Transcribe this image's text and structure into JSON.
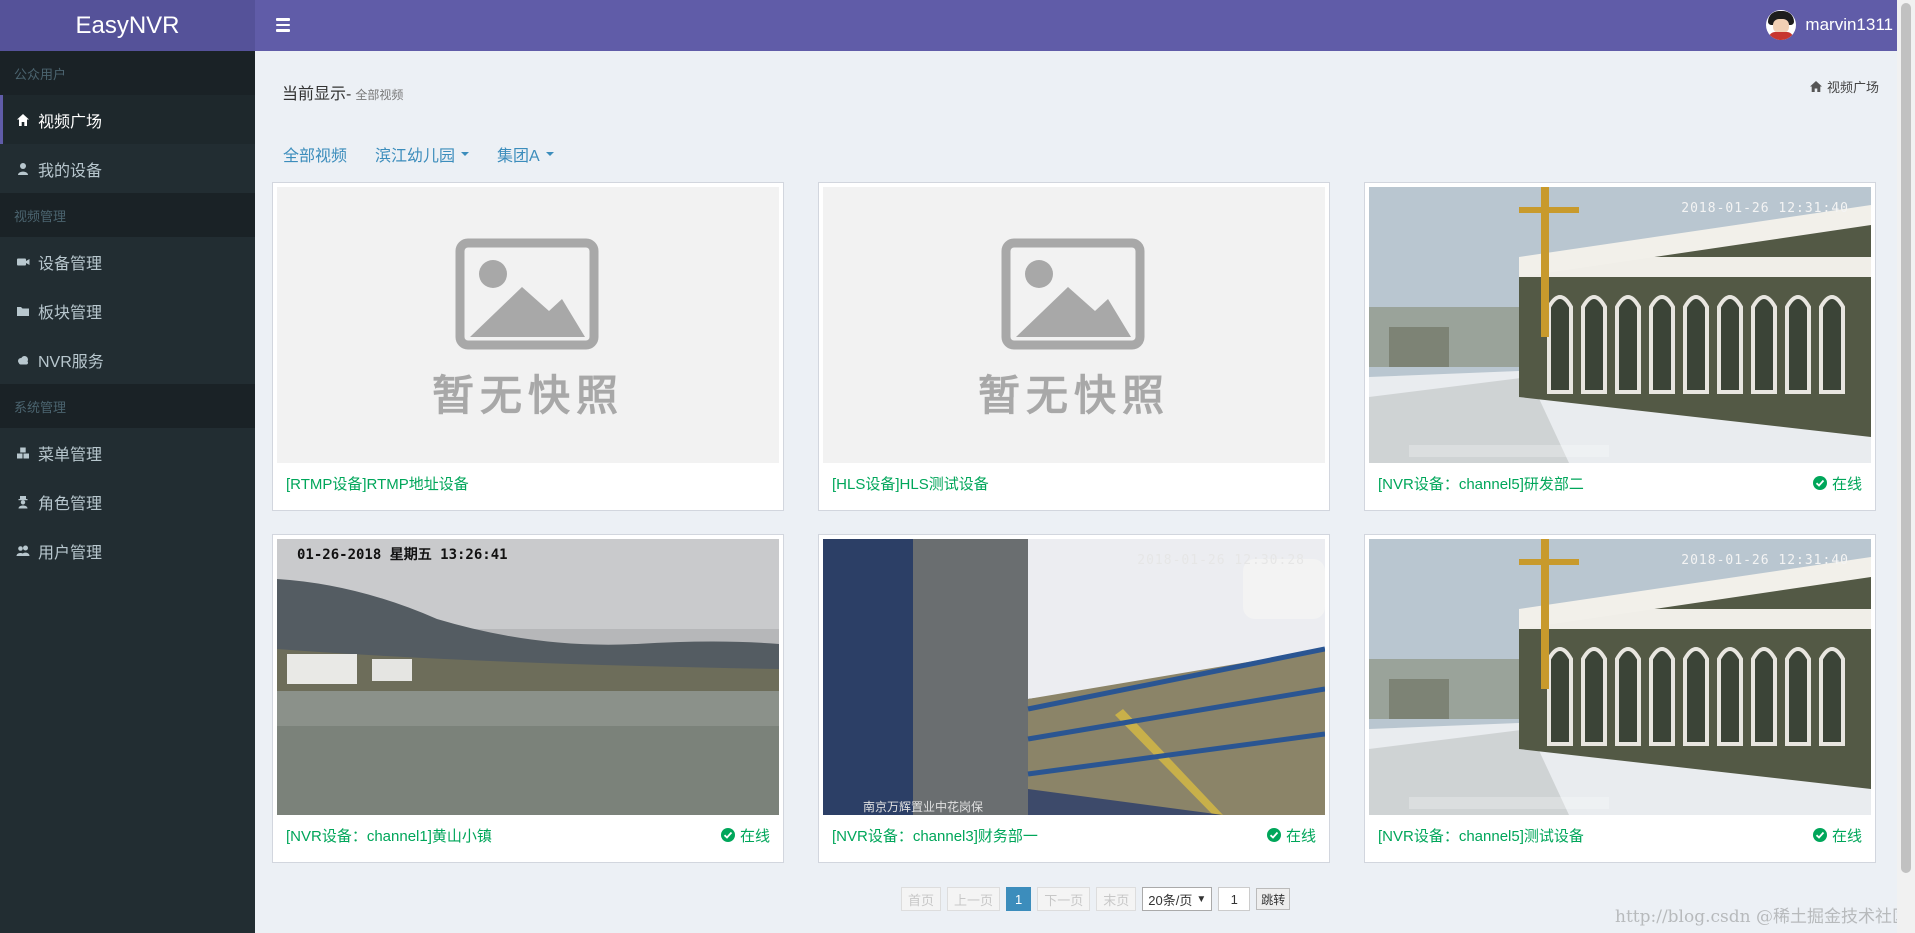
{
  "app": {
    "title": "EasyNVR"
  },
  "user": {
    "name": "marvin1311"
  },
  "sidebar": {
    "sections": [
      {
        "header": "公众用户",
        "items": [
          {
            "label": "视频广场",
            "icon": "home-icon",
            "active": true
          },
          {
            "label": "我的设备",
            "icon": "user-icon",
            "active": false
          }
        ]
      },
      {
        "header": "视频管理",
        "items": [
          {
            "label": "设备管理",
            "icon": "video-camera-icon",
            "active": false
          },
          {
            "label": "板块管理",
            "icon": "folder-icon",
            "active": false
          },
          {
            "label": "NVR服务",
            "icon": "cloud-icon",
            "active": false
          }
        ]
      },
      {
        "header": "系统管理",
        "items": [
          {
            "label": "菜单管理",
            "icon": "cubes-icon",
            "active": false
          },
          {
            "label": "角色管理",
            "icon": "user-secret-icon",
            "active": false
          },
          {
            "label": "用户管理",
            "icon": "users-icon",
            "active": false
          }
        ]
      }
    ]
  },
  "content": {
    "title": "当前显示-",
    "subtitle": "全部视频",
    "breadcrumb": "视频广场"
  },
  "filters": [
    {
      "label": "全部视频",
      "dropdown": false
    },
    {
      "label": "滨江幼儿园",
      "dropdown": true
    },
    {
      "label": "集团A",
      "dropdown": true
    }
  ],
  "cards": [
    {
      "name": "[RTMP设备]RTMP地址设备",
      "status": "",
      "thumb": "placeholder",
      "placeholder_text": "暂无快照"
    },
    {
      "name": "[HLS设备]HLS测试设备",
      "status": "",
      "thumb": "placeholder",
      "placeholder_text": "暂无快照"
    },
    {
      "name": "[NVR设备：channel5]研发部二",
      "status": "在线",
      "thumb": "building",
      "overlay": "2018-01-26 12:31:40"
    },
    {
      "name": "[NVR设备：channel1]黄山小镇",
      "status": "在线",
      "thumb": "lake",
      "overlay": "01-26-2018 星期五 13:26:41"
    },
    {
      "name": "[NVR设备：channel3]财务部一",
      "status": "在线",
      "thumb": "snow",
      "overlay": "2018-01-26 12:30:28",
      "overlay_bottom": "南京万辉置业中花岗保"
    },
    {
      "name": "[NVR设备：channel5]测试设备",
      "status": "在线",
      "thumb": "building",
      "overlay": "2018-01-26 12:31:40"
    }
  ],
  "pagination": {
    "first": "首页",
    "prev": "上一页",
    "current": "1",
    "next": "下一页",
    "last": "末页",
    "page_size": "20条/页",
    "jump_value": "1",
    "jump_label": "跳转"
  },
  "watermark": "http://blog.csdn @稀土掘金技术社区",
  "colors": {
    "header": "#605ca8",
    "logo_bg": "#555299",
    "sidebar": "#222d32",
    "online": "#00a65a",
    "link": "#3c8dbc"
  }
}
